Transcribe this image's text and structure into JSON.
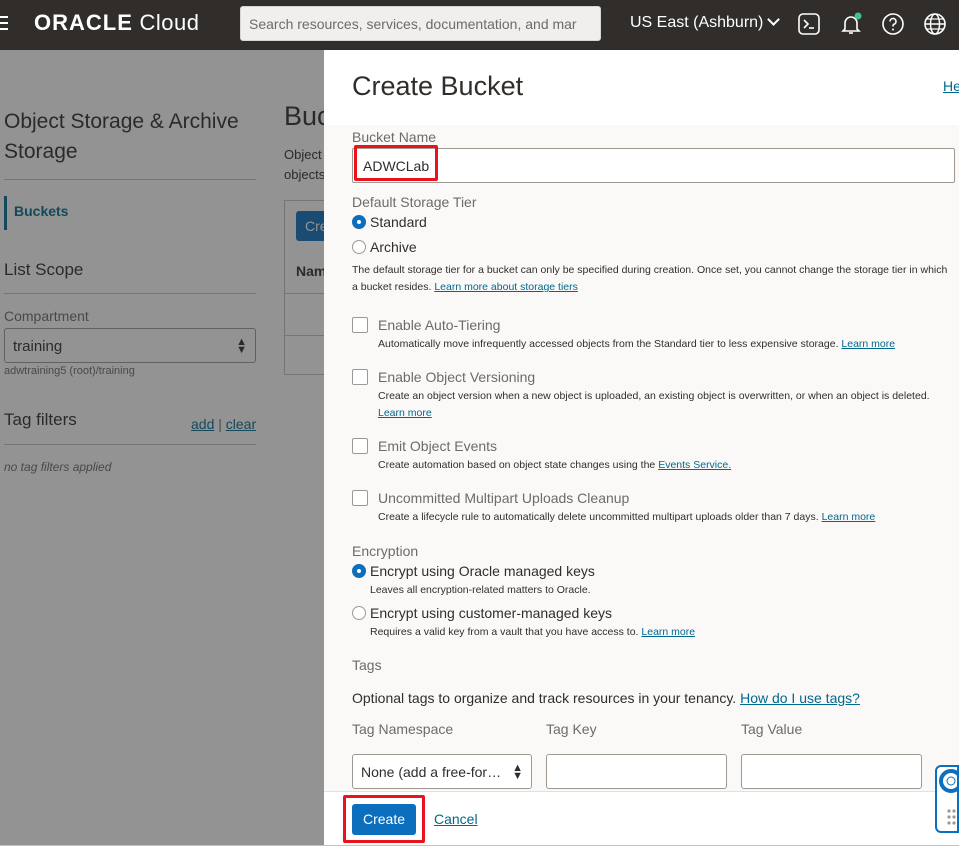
{
  "header": {
    "logo_bold": "ORACLE",
    "logo_light": " Cloud",
    "search_placeholder": "Search resources, services, documentation, and mar",
    "region": "US East (Ashburn)"
  },
  "sidebar": {
    "title": "Object Storage & Archive Storage",
    "buckets_label": "Buckets",
    "list_scope": "List Scope",
    "compartment_label": "Compartment",
    "compartment_value": "training",
    "compartment_path": "adwtraining5 (root)/training",
    "tag_filters": "Tag filters",
    "add_label": "add",
    "separator": "|",
    "clear_label": "clear",
    "no_tags": "no tag filters applied"
  },
  "main": {
    "heading": "Buckets",
    "desc_line1": "Object",
    "desc_line2": "objects",
    "create_label": "Create",
    "col_name": "Name"
  },
  "panel": {
    "title": "Create Bucket",
    "help_label": "Help",
    "bucket_name_label": "Bucket Name",
    "bucket_name_value": "ADWCLab",
    "storage_tier_label": "Default Storage Tier",
    "tier_standard": "Standard",
    "tier_archive": "Archive",
    "tier_help": "The default storage tier for a bucket can only be specified during creation. Once set, you cannot change the storage tier in which a bucket resides.",
    "tier_link": "Learn more about storage tiers",
    "auto_tiering_label": "Enable Auto-Tiering",
    "auto_tiering_help": "Automatically move infrequently accessed objects from the Standard tier to less expensive storage.",
    "versioning_label": "Enable Object Versioning",
    "versioning_help": "Create an object version when a new object is uploaded, an existing object is overwritten, or when an object is deleted.",
    "events_label": "Emit Object Events",
    "events_help": "Create automation based on object state changes using the",
    "events_link": "Events Service.",
    "multipart_label": "Uncommitted Multipart Uploads Cleanup",
    "multipart_help": "Create a lifecycle rule to automatically delete uncommitted multipart uploads older than 7 days.",
    "learn_more": "Learn more",
    "encryption_label": "Encryption",
    "enc_oracle": "Encrypt using Oracle managed keys",
    "enc_oracle_help": "Leaves all encryption-related matters to Oracle.",
    "enc_customer": "Encrypt using customer-managed keys",
    "enc_customer_help": "Requires a valid key from a vault that you have access to.",
    "tags_label": "Tags",
    "tags_intro": "Optional tags to organize and track resources in your tenancy.",
    "tags_link": "How do I use tags?",
    "tag_namespace_label": "Tag Namespace",
    "tag_key_label": "Tag Key",
    "tag_value_label": "Tag Value",
    "tag_namespace_value": "None (add a free-for…",
    "create_button": "Create",
    "cancel_button": "Cancel"
  },
  "colors": {
    "topbar": "#312d2a",
    "accent": "#0c6fbd",
    "link": "#00688c",
    "highlight": "#e8131c"
  }
}
